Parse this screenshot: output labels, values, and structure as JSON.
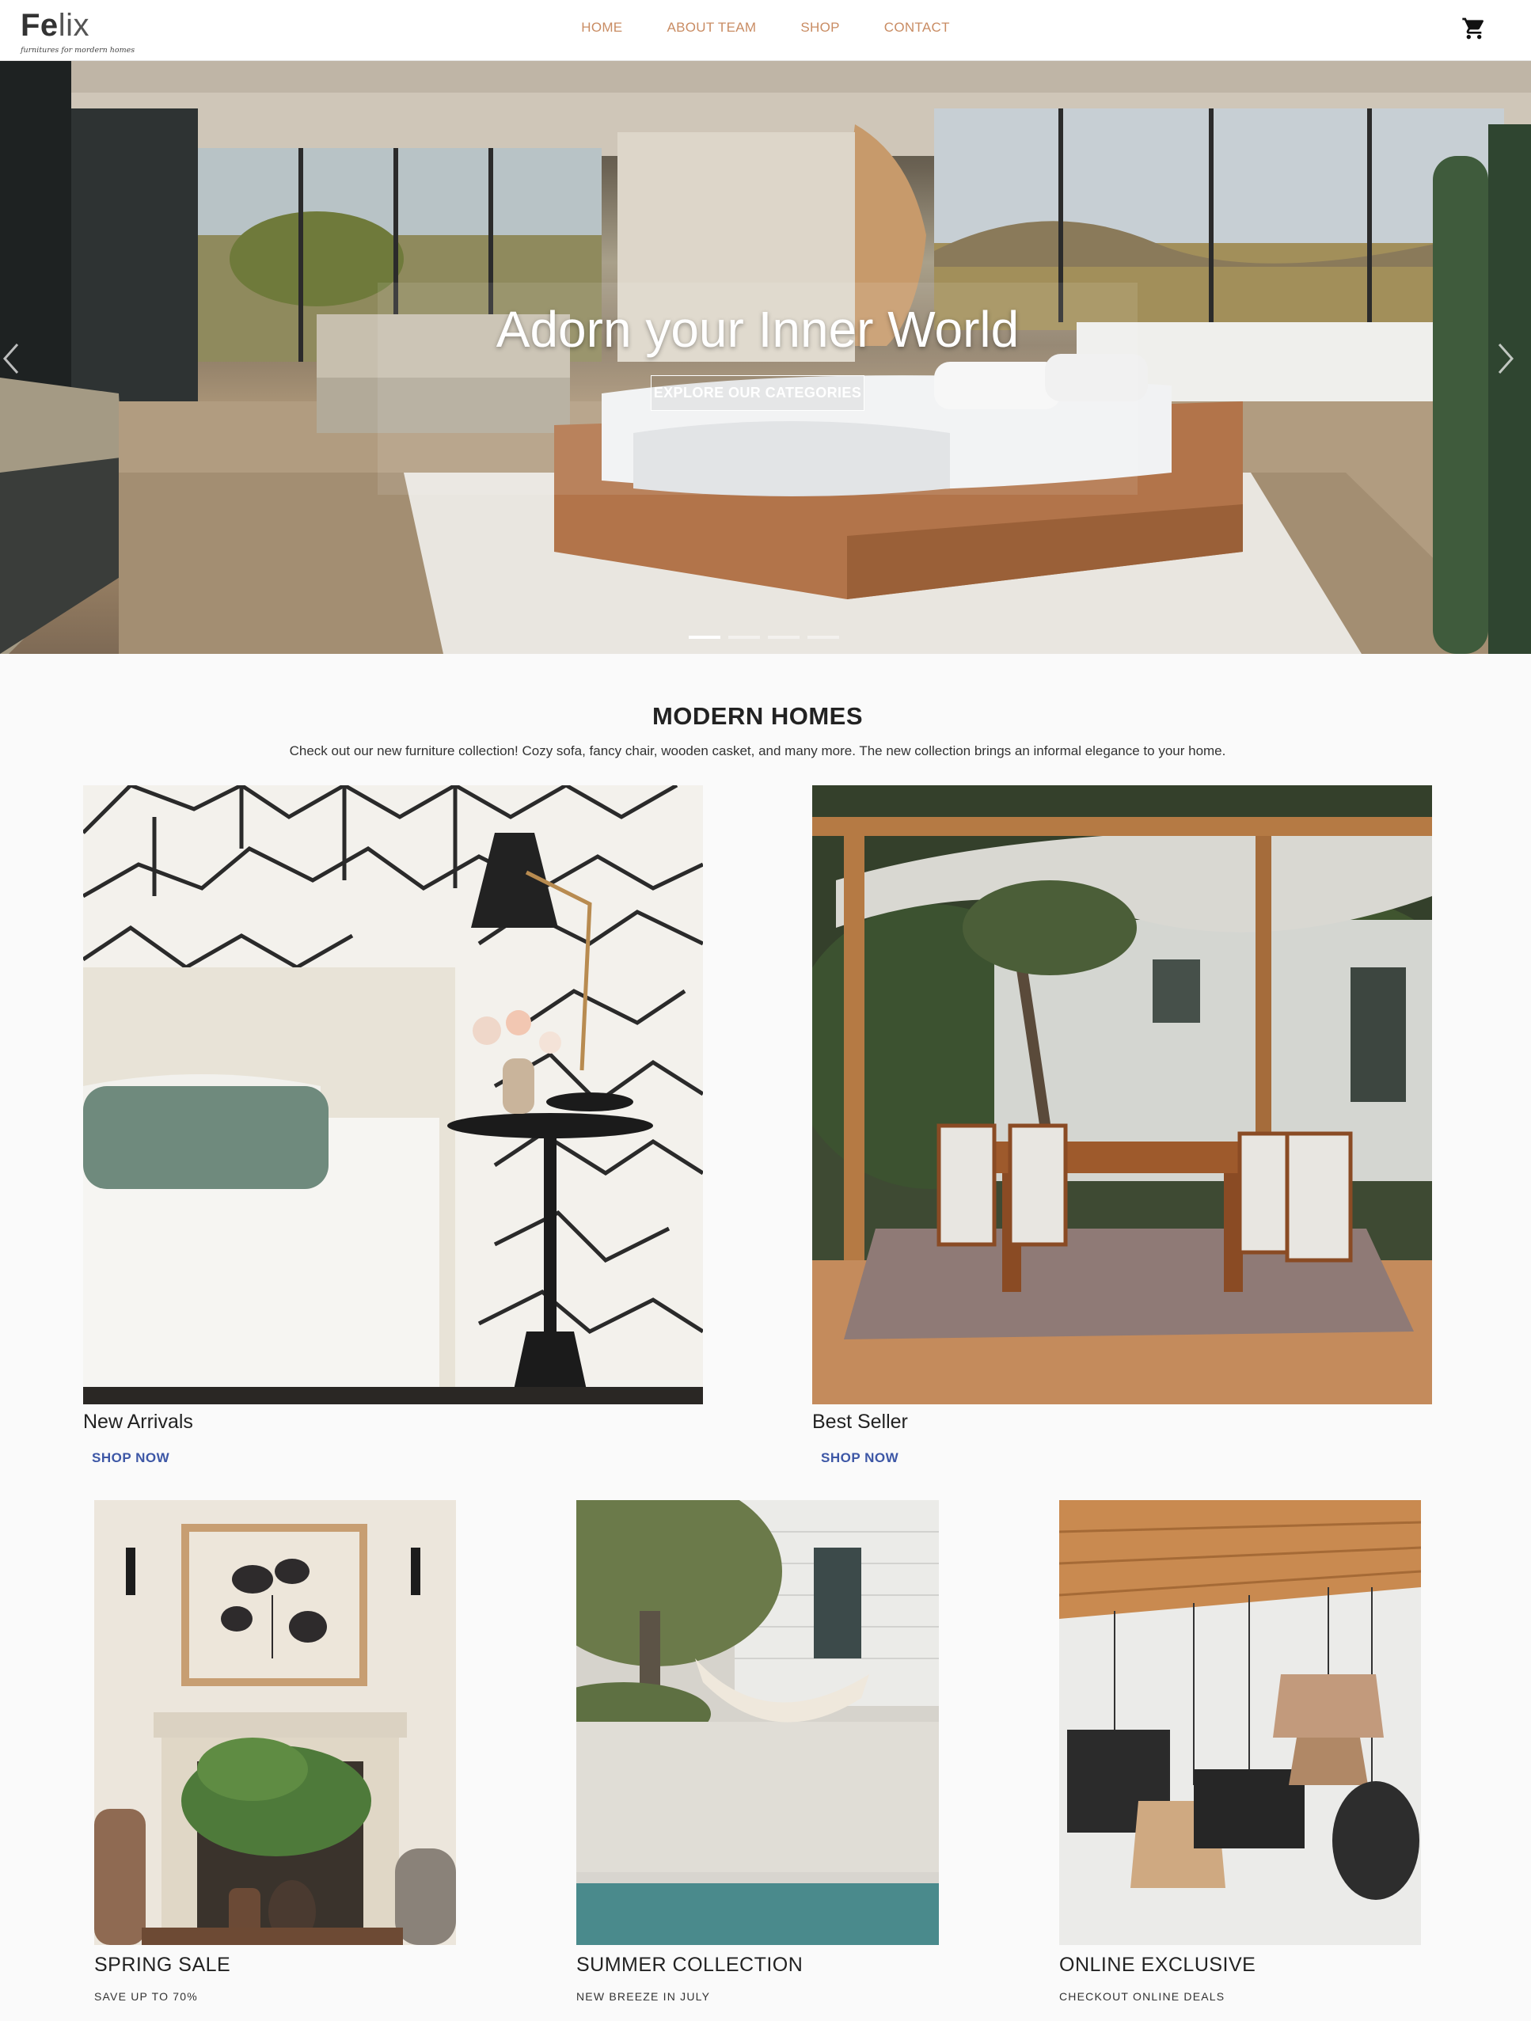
{
  "nav": {
    "logo_bold": "Fe",
    "logo_light": "lix",
    "logo_tagline": "furnitures for mordern homes",
    "items": [
      "HOME",
      "ABOUT TEAM",
      "SHOP",
      "CONTACT"
    ],
    "cart_icon": "shopping-cart-icon"
  },
  "hero": {
    "title": "Adorn your Inner World",
    "button": "EXPLORE OUR CATEGORIES",
    "slide_count": 4,
    "active_slide": 1
  },
  "section": {
    "title": "MODERN HOMES",
    "description": "Check out our new furniture collection! Cozy sofa, fancy chair, wooden casket, and many more. The new collection brings an informal elegance to your home."
  },
  "featured": [
    {
      "title": "New Arrivals",
      "link": "SHOP NOW"
    },
    {
      "title": "Best Seller",
      "link": "SHOP NOW"
    }
  ],
  "collections": [
    {
      "title": "SPRING SALE",
      "subtitle": "SAVE UP TO 70%"
    },
    {
      "title": "SUMMER COLLECTION",
      "subtitle": "NEW BREEZE IN JULY"
    },
    {
      "title": "ONLINE EXCLUSIVE",
      "subtitle": "CHECKOUT ONLINE DEALS"
    }
  ]
}
